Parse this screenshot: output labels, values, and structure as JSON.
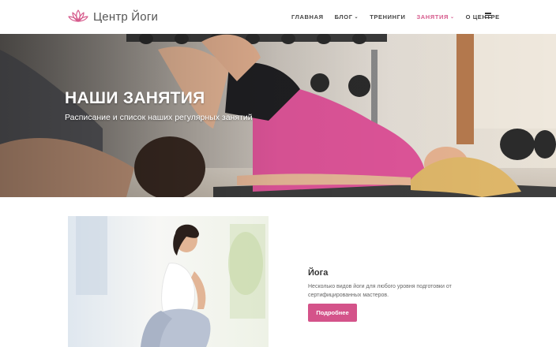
{
  "brand": {
    "name": "Центр Йоги",
    "logo_icon": "lotus-icon",
    "accent_color": "#d4538a"
  },
  "nav": {
    "items": [
      {
        "label": "ГЛАВНАЯ",
        "active": false,
        "has_dropdown": false
      },
      {
        "label": "БЛОГ",
        "active": false,
        "has_dropdown": true
      },
      {
        "label": "ТРЕНИНГИ",
        "active": false,
        "has_dropdown": false
      },
      {
        "label": "ЗАНЯТИЯ",
        "active": true,
        "has_dropdown": true
      },
      {
        "label": "О ЦЕНТРЕ",
        "active": false,
        "has_dropdown": false
      }
    ],
    "menu_icon": "hamburger-icon"
  },
  "hero": {
    "title": "НАШИ ЗАНЯТИЯ",
    "subtitle": "Расписание и список наших регулярных занятий"
  },
  "classes": [
    {
      "title": "Йога",
      "description": "Несколько видов йоги для любого уровня подготовки от сертифицированных мастеров.",
      "button_label": "Подробнее"
    }
  ]
}
